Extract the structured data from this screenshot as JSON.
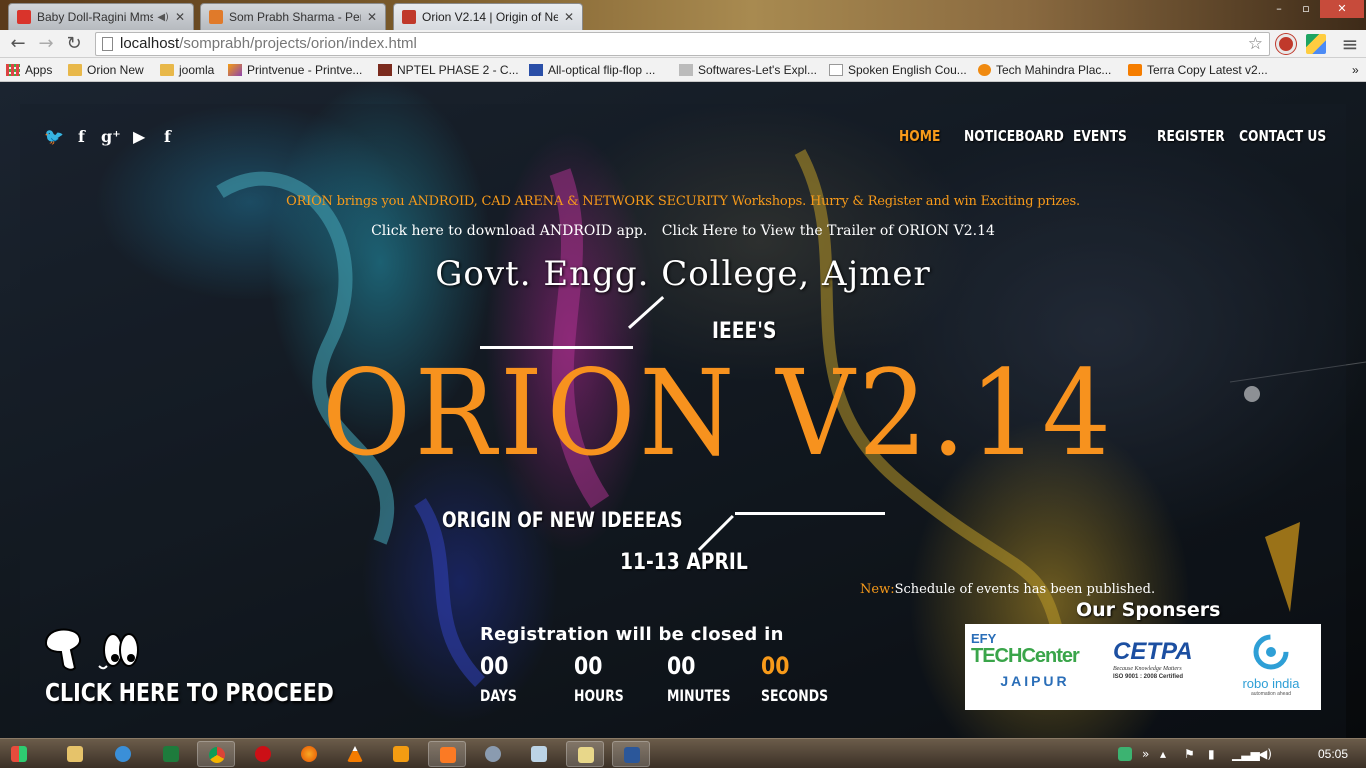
{
  "browser": {
    "tabs": [
      {
        "label": "Baby Doll-Ragini Mms",
        "favicon_color": "#d9342b",
        "active": false
      },
      {
        "label": "Som Prabh Sharma - Pers",
        "favicon_color": "#e07a2a",
        "active": false
      },
      {
        "label": "Orion V2.14 | Origin of Ne",
        "favicon_color": "#c0392b",
        "active": true
      }
    ],
    "window_controls": {
      "minimize": "–",
      "maximize": "▫",
      "close": "✕"
    },
    "nav": {
      "back": "←",
      "forward": "→",
      "reload": "↻"
    },
    "url": {
      "host": "localhost",
      "path": "/somprabh/projects/orion/index.html"
    },
    "star": "☆",
    "menu": "≡",
    "bookmarks": [
      {
        "label": "Apps",
        "icon": "apps-grid-icon"
      },
      {
        "label": "Orion New",
        "icon": "folder-icon"
      },
      {
        "label": "joomla",
        "icon": "folder-icon"
      },
      {
        "label": "Printvenue - Printve...",
        "icon": "printvenue-icon"
      },
      {
        "label": "NPTEL PHASE 2 - C...",
        "icon": "nptel-icon"
      },
      {
        "label": "All-optical flip-flop ...",
        "icon": "page-icon"
      },
      {
        "label": "Softwares-Let's Expl...",
        "icon": "page-icon"
      },
      {
        "label": "Spoken English Cou...",
        "icon": "page-icon"
      },
      {
        "label": "Tech Mahindra Plac...",
        "icon": "orange-circle-icon"
      },
      {
        "label": "Terra Copy Latest v2...",
        "icon": "blogger-icon"
      }
    ]
  },
  "site": {
    "social": [
      "twitter-icon",
      "facebook-icon",
      "google-plus-icon",
      "youtube-icon",
      "facebook-icon"
    ],
    "social_glyphs": [
      "🐦",
      "f",
      "g⁺",
      "▶",
      "f"
    ],
    "nav": [
      {
        "label": "HOME",
        "active": true
      },
      {
        "label": "NOTICEBOARD",
        "active": false
      },
      {
        "label": "EVENTS",
        "active": false
      },
      {
        "label": "REGISTER",
        "active": false
      },
      {
        "label": "CONTACT US",
        "active": false
      }
    ],
    "announcement": "ORION brings you ANDROID, CAD ARENA & NETWORK SECURITY Workshops. Hurry & Register and win Exciting prizes.",
    "link_android": "Click here to download ANDROID app.",
    "link_trailer": "Click Here to View the Trailer of ORION V2.14",
    "college": "Govt. Engg. College, Ajmer",
    "ieee": "IEEE'S",
    "title": "ORION V2.14",
    "tagline": "ORIGIN OF NEW IDEEEAS",
    "dates": "11-13 APRIL",
    "news_new": "New:",
    "news_text": "Schedule of events has been published.",
    "proceed": "CLICK HERE TO PROCEED",
    "countdown": {
      "title": "Registration will be closed in",
      "units": [
        {
          "value": "00",
          "label": "DAYS"
        },
        {
          "value": "00",
          "label": "HOURS"
        },
        {
          "value": "00",
          "label": "MINUTES"
        },
        {
          "value": "00",
          "label": "SECONDS"
        }
      ]
    },
    "sponsors_title": "Our Sponsers",
    "sponsors": {
      "efy_top": "EFY",
      "efy_main": "TECHCenter",
      "efy_city": "JAIPUR",
      "cetpa": "CETPA",
      "cetpa_tag": "Because Knowledge Matters",
      "cetpa_iso": "ISO 9001 : 2008 Certified",
      "robo": "robo india",
      "robo_tag": "automation ahead"
    },
    "accent_color": "#f7921e"
  },
  "taskbar": {
    "clock": "05:05",
    "items": [
      "start",
      "explorer",
      "ie",
      "excel",
      "chrome",
      "opera",
      "firefox",
      "vlc",
      "media",
      "xampp",
      "network",
      "notes",
      "paint",
      "word"
    ]
  }
}
